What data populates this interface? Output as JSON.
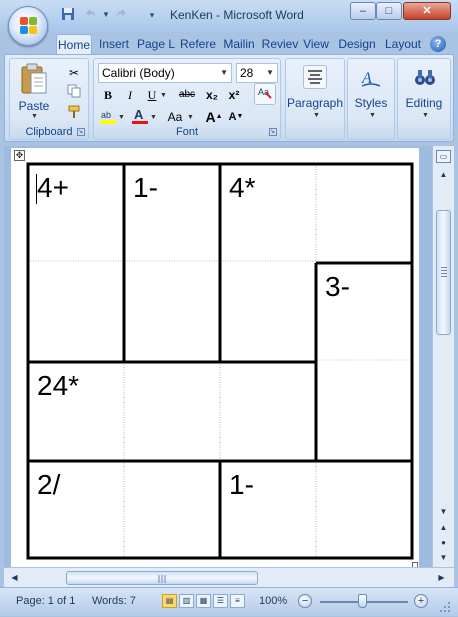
{
  "window": {
    "title": "KenKen - Microsoft Word",
    "minimize": "–",
    "maximize": "□",
    "close": "✕"
  },
  "quick_access": {
    "save_icon": "save-icon",
    "undo_icon": "undo-icon",
    "redo_icon": "redo-icon"
  },
  "tabs": [
    "Home",
    "Insert",
    "Page L",
    "Refere",
    "Mailin",
    "Reviev",
    "View",
    "Design",
    "Layout"
  ],
  "active_tab": "Home",
  "ribbon": {
    "clipboard": {
      "label": "Clipboard",
      "paste_label": "Paste"
    },
    "font": {
      "label": "Font",
      "font_name": "Calibri (Body)",
      "font_size": "28",
      "bold": "B",
      "italic": "I",
      "underline": "U",
      "strikethrough": "abc",
      "subscript": "x₂",
      "superscript": "x²",
      "change_case": "Aa",
      "grow_font": "A",
      "shrink_font": "A"
    },
    "paragraph": {
      "label": "Paragraph"
    },
    "styles": {
      "label": "Styles"
    },
    "editing": {
      "label": "Editing"
    }
  },
  "document": {
    "grid_size": 4,
    "cages": [
      {
        "label": "4+",
        "cell": [
          0,
          0
        ]
      },
      {
        "label": "1-",
        "cell": [
          0,
          1
        ]
      },
      {
        "label": "4*",
        "cell": [
          0,
          2
        ]
      },
      {
        "label": "3-",
        "cell": [
          1,
          3
        ]
      },
      {
        "label": "24*",
        "cell": [
          2,
          0
        ]
      },
      {
        "label": "2/",
        "cell": [
          3,
          0
        ]
      },
      {
        "label": "1-",
        "cell": [
          3,
          2
        ]
      }
    ]
  },
  "status": {
    "page": "Page: 1 of 1",
    "words": "Words: 7",
    "zoom": "100%",
    "zoom_out": "−",
    "zoom_in": "+"
  }
}
